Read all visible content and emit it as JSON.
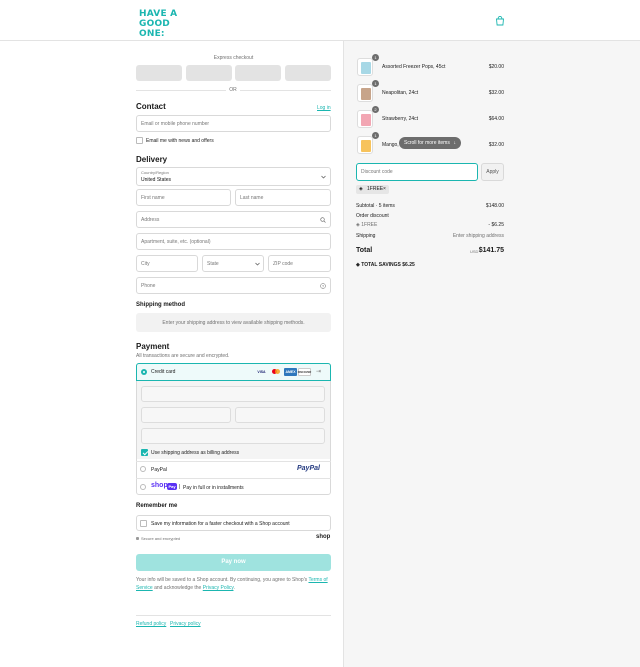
{
  "header": {
    "logo_line1": "HAVE A",
    "logo_line2": "GOOD ONE:",
    "cart_icon": "shopping-bag-icon"
  },
  "express": {
    "title": "Express checkout",
    "or_label": "OR"
  },
  "contact": {
    "heading": "Contact",
    "login_label": "Log in",
    "email_placeholder": "Email or mobile phone number",
    "newsletter_label": "Email me with news and offers"
  },
  "delivery": {
    "heading": "Delivery",
    "country_label": "Country/Region",
    "country_value": "United States",
    "first_name_placeholder": "First name",
    "last_name_placeholder": "Last name",
    "address_placeholder": "Address",
    "apartment_placeholder": "Apartment, suite, etc. (optional)",
    "city_placeholder": "City",
    "state_placeholder": "State",
    "zip_placeholder": "ZIP code",
    "phone_placeholder": "Phone"
  },
  "shipping_method": {
    "heading": "Shipping method",
    "notice": "Enter your shipping address to view available shipping methods."
  },
  "payment": {
    "heading": "Payment",
    "subtitle": "All transactions are secure and encrypted.",
    "credit_card_label": "Credit card",
    "card_brands": [
      "VISA",
      "mastercard",
      "AMEX",
      "DISCOVER"
    ],
    "billing_same_label": "Use shipping address as billing address",
    "paypal_label": "PayPal",
    "paypal_logo": "PayPal",
    "shoppay_logo": "shop",
    "shoppay_badge": "Pay",
    "shoppay_desc": "Pay in full or in installments"
  },
  "remember": {
    "heading": "Remember me",
    "save_label": "Save my information for a faster checkout with a Shop account",
    "secure_label": "Secure and encrypted",
    "shop_brand": "shop"
  },
  "pay_button": "Pay now",
  "legal": {
    "text_before": "Your info will be saved to a Shop account. By continuing, you agree to Shop's ",
    "terms_link": "Terms of Service",
    "text_middle": " and acknowledge the ",
    "privacy_link": "Privacy Policy",
    "text_after": "."
  },
  "footer": {
    "refund_link": "Refund policy",
    "privacy_link": "Privacy policy"
  },
  "order": {
    "items": [
      {
        "name": "Assorted Freezer Pops, 45ct",
        "qty": "1",
        "price": "$20.00",
        "color": "#a7d8e6"
      },
      {
        "name": "Neapolitan, 24ct",
        "qty": "1",
        "price": "$32.00",
        "color": "#c7a48a"
      },
      {
        "name": "Strawberry, 24ct",
        "qty": "2",
        "price": "$64.00",
        "color": "#f2a6b3"
      },
      {
        "name": "Mango,",
        "qty": "1",
        "price": "$32.00",
        "color": "#f7c35c"
      }
    ],
    "scroll_hint": "Scroll for more items",
    "discount_placeholder": "Discount code",
    "apply_label": "Apply",
    "applied_code": "1FREE",
    "subtotal_label": "Subtotal · 5 items",
    "subtotal_value": "$148.00",
    "order_discount_label": "Order discount",
    "discount_code": "1FREE",
    "discount_value": "- $6.25",
    "shipping_label": "Shipping",
    "shipping_value": "Enter shipping address",
    "total_label": "Total",
    "currency": "USD",
    "total_value": "$141.75",
    "savings_label": "TOTAL SAVINGS",
    "savings_value": "$6.25"
  },
  "colors": {
    "accent": "#1bb6b0",
    "pay_button_bg": "#9fe3df"
  }
}
